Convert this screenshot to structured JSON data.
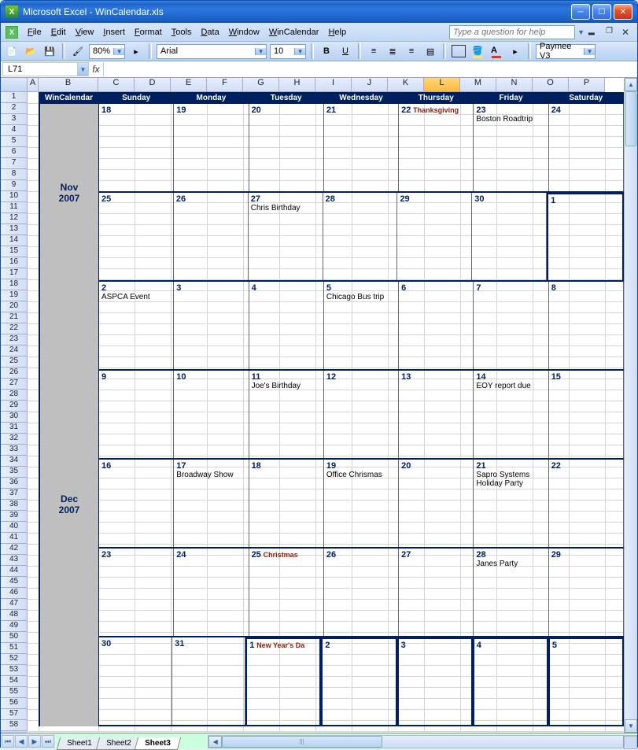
{
  "window": {
    "title": "Microsoft Excel - WinCalendar.xls"
  },
  "menus": [
    "File",
    "Edit",
    "View",
    "Insert",
    "Format",
    "Tools",
    "Data",
    "Window",
    "WinCalendar",
    "Help"
  ],
  "helpPlaceholder": "Type a question for help",
  "toolbar": {
    "zoom": "80%",
    "font": "Arial",
    "size": "10",
    "paymee": "Paymee V3"
  },
  "namebox": "L71",
  "cols": [
    "A",
    "B",
    "C",
    "D",
    "E",
    "F",
    "G",
    "H",
    "I",
    "J",
    "K",
    "L",
    "M",
    "N",
    "O",
    "P"
  ],
  "selCol": "L",
  "rows": 58,
  "calendar": {
    "brand": "WinCalendar",
    "days": [
      "Sunday",
      "Monday",
      "Tuesday",
      "Wednesday",
      "Thursday",
      "Friday",
      "Saturday"
    ],
    "months": [
      {
        "label": "Nov 2007",
        "rows": 2,
        "weeks": [
          [
            {
              "n": 18
            },
            {
              "n": 19
            },
            {
              "n": 20
            },
            {
              "n": 21
            },
            {
              "n": 22,
              "holiday": "Thanksgiving"
            },
            {
              "n": 23,
              "events": [
                "Boston Roadtrip"
              ]
            },
            {
              "n": 24
            }
          ],
          [
            {
              "n": 25
            },
            {
              "n": 26
            },
            {
              "n": 27,
              "events": [
                "Chris Birthday"
              ]
            },
            {
              "n": 28
            },
            {
              "n": 29
            },
            {
              "n": 30
            },
            {
              "n": 1,
              "next": true
            }
          ]
        ]
      },
      {
        "label": "Dec 2007",
        "rows": 5,
        "weeks": [
          [
            {
              "n": 2,
              "events": [
                "ASPCA Event"
              ]
            },
            {
              "n": 3
            },
            {
              "n": 4
            },
            {
              "n": 5,
              "events": [
                "Chicago Bus trip"
              ]
            },
            {
              "n": 6
            },
            {
              "n": 7
            },
            {
              "n": 8
            }
          ],
          [
            {
              "n": 9
            },
            {
              "n": 10
            },
            {
              "n": 11,
              "events": [
                "Joe's Birthday"
              ]
            },
            {
              "n": 12
            },
            {
              "n": 13
            },
            {
              "n": 14,
              "events": [
                "EOY report due"
              ]
            },
            {
              "n": 15
            }
          ],
          [
            {
              "n": 16
            },
            {
              "n": 17,
              "events": [
                "Broadway Show"
              ]
            },
            {
              "n": 18
            },
            {
              "n": 19,
              "events": [
                "Office Chrismas"
              ]
            },
            {
              "n": 20
            },
            {
              "n": 21,
              "events": [
                "Sapro Systems",
                "Holiday Party"
              ]
            },
            {
              "n": 22
            }
          ],
          [
            {
              "n": 23
            },
            {
              "n": 24
            },
            {
              "n": 25,
              "holiday": "Christmas"
            },
            {
              "n": 26
            },
            {
              "n": 27
            },
            {
              "n": 28,
              "events": [
                "Janes Party"
              ]
            },
            {
              "n": 29
            }
          ],
          [
            {
              "n": 30
            },
            {
              "n": 31
            },
            {
              "n": 1,
              "holiday": "New Year's Da",
              "next": true
            },
            {
              "n": 2,
              "next": true
            },
            {
              "n": 3,
              "next": true
            },
            {
              "n": 4,
              "next": true
            },
            {
              "n": 5,
              "next": true
            }
          ]
        ]
      }
    ]
  },
  "sheets": [
    "Sheet1",
    "Sheet2",
    "Sheet3"
  ],
  "activeSheet": "Sheet3"
}
